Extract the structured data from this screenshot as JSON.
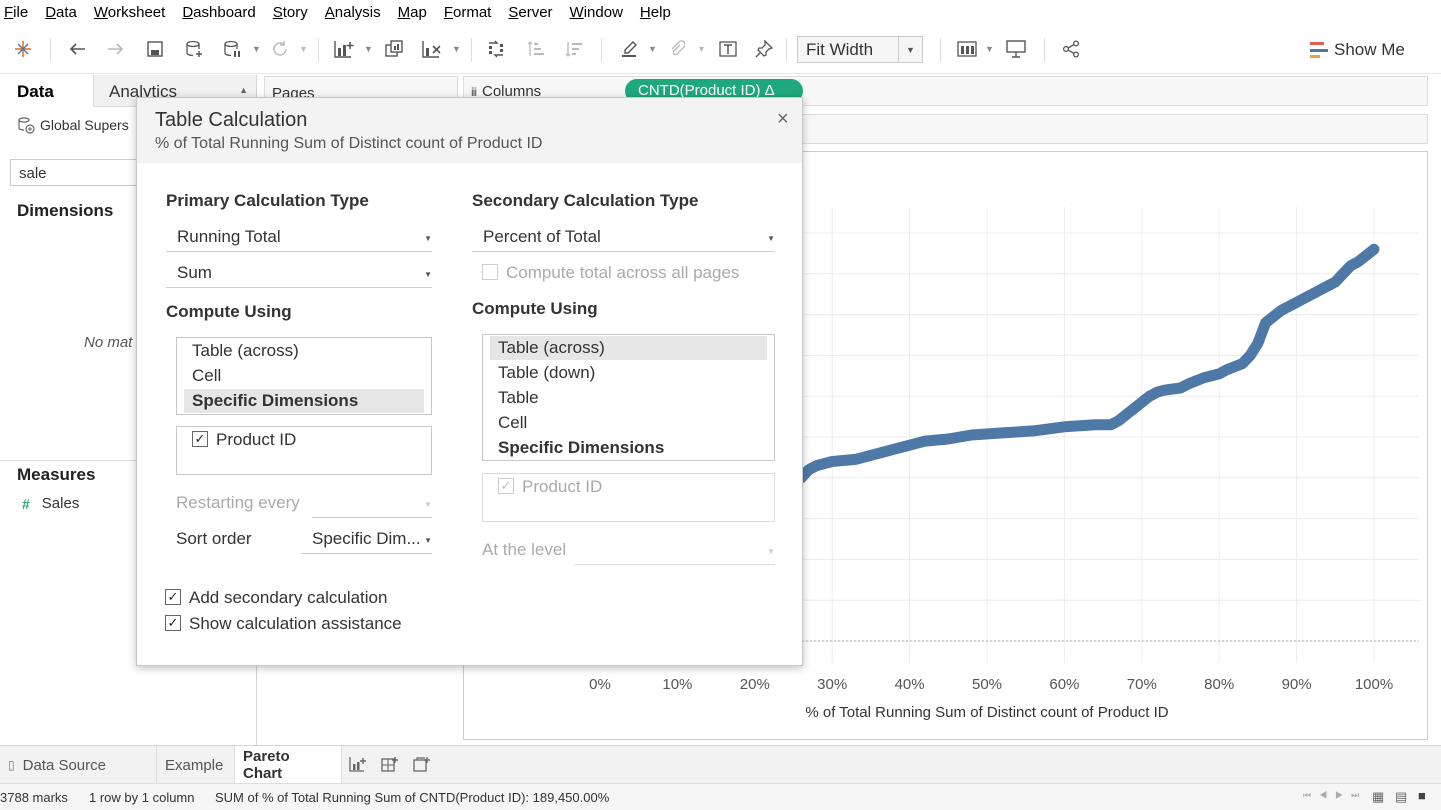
{
  "menu": [
    "File",
    "Data",
    "Worksheet",
    "Dashboard",
    "Story",
    "Analysis",
    "Map",
    "Format",
    "Server",
    "Window",
    "Help"
  ],
  "toolbar": {
    "fit": "Fit Width",
    "show_me": "Show Me",
    "icons": [
      "tableau-logo-icon",
      "undo-icon",
      "redo-icon",
      "save-icon",
      "new-datasource-icon",
      "pause-updates-icon",
      "refresh-icon",
      "new-worksheet-icon",
      "duplicate-icon",
      "clear-icon",
      "swap-icon",
      "sort-asc-icon",
      "sort-desc-icon",
      "highlight-icon",
      "group-icon",
      "label-icon",
      "pin-icon",
      "show-cards-icon",
      "presentation-icon",
      "share-icon"
    ],
    "show_me_colors": [
      "#e05c4b",
      "#4e79a7",
      "#f0a03c"
    ]
  },
  "left": {
    "tab_data": "Data",
    "tab_analytics": "Analytics",
    "datasource": "Global Supers",
    "search": "sale",
    "dimensions": "Dimensions",
    "no_match": "No mat",
    "measures": "Measures",
    "sales": "Sales",
    "hash": "#"
  },
  "shelves": {
    "pages": "Pages",
    "columns": "Columns",
    "columns_pill": "CNTD(Product ID)  Δ"
  },
  "dialog": {
    "title": "Table Calculation",
    "subtitle": "% of Total Running Sum of Distinct count of Product ID",
    "close": "×",
    "primary": {
      "heading": "Primary Calculation Type",
      "type": "Running Total",
      "aggregation": "Sum",
      "compute_heading": "Compute Using",
      "options": [
        "Table (across)",
        "Cell",
        "Specific Dimensions"
      ],
      "dimension": "Product ID",
      "restarting": "Restarting every",
      "sort_label": "Sort order",
      "sort_value": "Specific Dim..."
    },
    "secondary": {
      "heading": "Secondary Calculation Type",
      "type": "Percent of Total",
      "compute_all_pages": "Compute total across all pages",
      "compute_heading": "Compute Using",
      "options": [
        "Table (across)",
        "Table (down)",
        "Table",
        "Cell",
        "Specific Dimensions"
      ],
      "dimension": "Product ID",
      "at_level": "At the level"
    },
    "add_secondary": "Add secondary calculation",
    "show_assistance": "Show calculation assistance",
    "check": "✓"
  },
  "chart_data": {
    "type": "line",
    "xlabel": "% of Total Running Sum of Distinct count of Product ID",
    "x_ticks": [
      "0%",
      "10%",
      "20%",
      "30%",
      "40%",
      "50%",
      "60%",
      "70%",
      "80%",
      "90%",
      "100%"
    ],
    "xlim": [
      0,
      100
    ],
    "ylim": [
      0,
      100
    ],
    "color": "#4e79a7",
    "x": [
      26,
      27,
      28,
      30,
      33,
      36,
      38,
      40,
      42,
      45,
      48,
      52,
      56,
      60,
      64,
      66,
      67,
      68,
      69,
      71,
      72,
      73,
      75,
      76,
      78,
      80,
      81,
      83,
      84,
      85,
      86,
      87,
      88,
      90,
      92,
      94,
      95,
      96,
      97,
      98,
      100
    ],
    "y": [
      40,
      42,
      43,
      44,
      44.5,
      46,
      47,
      48,
      49,
      49.5,
      50.5,
      51,
      51.5,
      52.5,
      53,
      53,
      54,
      55.5,
      57,
      60,
      61,
      61.5,
      62,
      63,
      64.5,
      65.5,
      66.5,
      68,
      70,
      73,
      78,
      79.5,
      81,
      83,
      85,
      87,
      88,
      90,
      92,
      93,
      96
    ]
  },
  "sheets": {
    "data_source": "Data Source",
    "tabs": [
      "Example",
      "Pareto Chart"
    ],
    "active": "Pareto Chart"
  },
  "status": {
    "marks": "3788 marks",
    "rows": "1 row by 1 column",
    "sum": "SUM of % of Total Running Sum of CNTD(Product ID): 189,450.00%"
  }
}
